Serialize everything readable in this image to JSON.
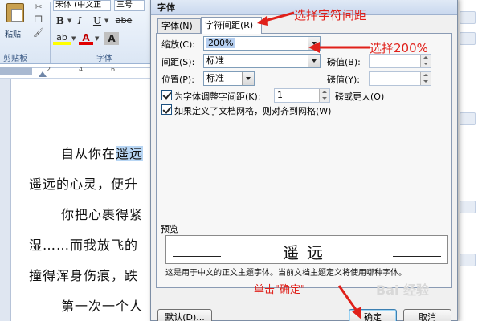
{
  "ribbon": {
    "paste_label": "粘贴",
    "clipboard_group_label": "剪贴板",
    "font_group_label": "字体",
    "font_name": "宋体 (中文正",
    "font_size": "三号",
    "bold_label": "B",
    "italic_label": "I",
    "underline_label": "U",
    "strike_label": "abe",
    "highlight_label": "ab",
    "font_color_label": "A",
    "char_shade_label": "A"
  },
  "ruler": {
    "marks": [
      "2",
      "4",
      "6"
    ]
  },
  "document": {
    "line1_prefix": "自从你在",
    "line1_selected": "遥远",
    "line2": "遥远的心灵，便升",
    "line3": "你把心裹得紧",
    "line4": "湿……而我放飞的",
    "line5": "撞得浑身伤痕，跌",
    "line6": "第一次一个人"
  },
  "dialog": {
    "title": "字体",
    "tabs": {
      "font": "字体(N)",
      "spacing": "字符间距(R)"
    },
    "scale_label": "缩放(C):",
    "scale_value": "200%",
    "spacing_label": "间距(S):",
    "spacing_value": "标准",
    "spacing_by_label": "磅值(B):",
    "position_label": "位置(P):",
    "position_value": "标准",
    "position_by_label": "磅值(Y):",
    "kerning_label": "为字体调整字间距(K):",
    "kerning_value": "1",
    "kerning_suffix": "磅或更大(O)",
    "snap_grid_label": "如果定义了文档网格，则对齐到网格(W)",
    "preview_label": "预览",
    "preview_text": "遥远",
    "preview_caption": "这是用于中文的正文主题字体。当前文档主题定义将使用哪种字体。",
    "default_button": "默认(D)...",
    "ok_button": "确定",
    "cancel_button": "取消"
  },
  "annotations": {
    "tab_hint": "选择字符间距",
    "scale_hint": "选择200%",
    "ok_hint": "单击\"确定\""
  },
  "watermark": "Bai 经验",
  "colors": {
    "annotation": "#e0201a",
    "selection": "#b8d6f4"
  }
}
